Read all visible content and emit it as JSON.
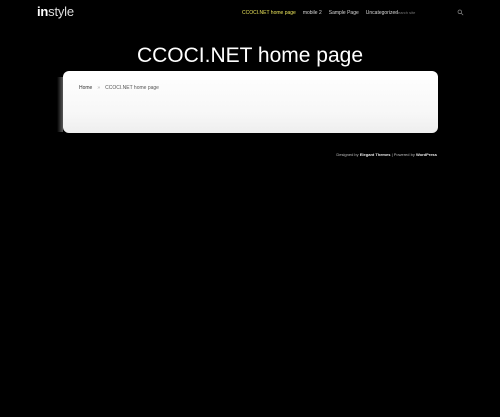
{
  "header": {
    "logo": {
      "bold": "in",
      "light": "style"
    },
    "nav": [
      {
        "label": "CCOCI.NET home page",
        "active": true
      },
      {
        "label": "mobile 2",
        "active": false
      },
      {
        "label": "Sample Page",
        "active": false
      },
      {
        "label": "Uncategorized",
        "active": false
      }
    ],
    "search": {
      "placeholder": "search site",
      "icon": "search-icon"
    }
  },
  "main": {
    "title": "CCOCI.NET home page",
    "breadcrumb": {
      "home": "Home",
      "separator": "»",
      "current": "CCOCI.NET home page"
    }
  },
  "footer": {
    "designed_by_prefix": "Designed by ",
    "designer": "Elegant Themes",
    "powered_by_prefix": " | Powered by ",
    "platform": "WordPress"
  },
  "colors": {
    "background": "#000000",
    "nav_active": "#e9e35a",
    "content_bg": "#ffffff"
  }
}
